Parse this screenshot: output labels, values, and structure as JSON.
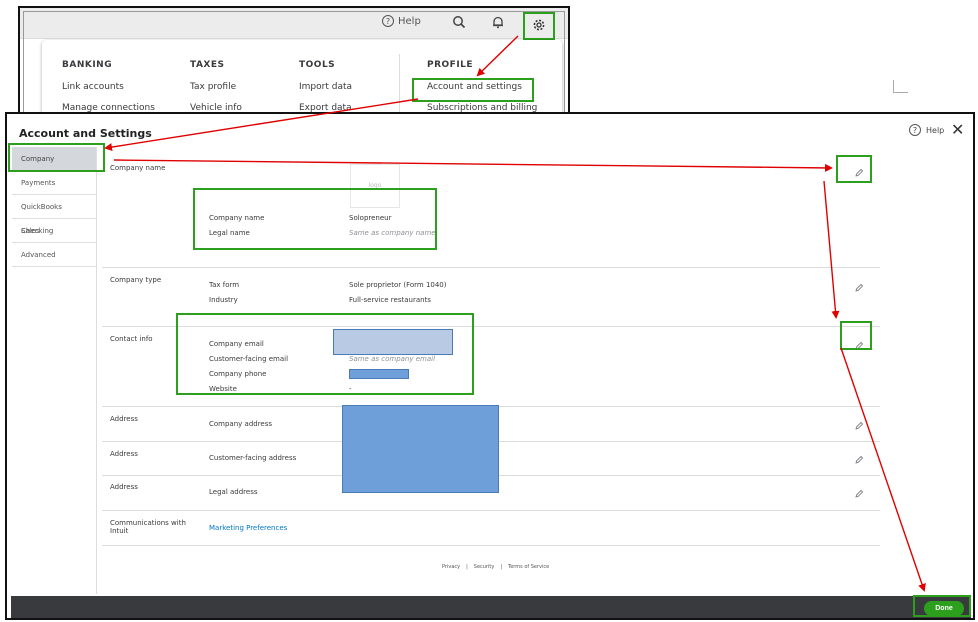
{
  "topbar": {
    "help_label": "Help"
  },
  "gear_menu": {
    "columns": [
      {
        "heading": "BANKING",
        "items": [
          "Link accounts",
          "Manage connections"
        ]
      },
      {
        "heading": "TAXES",
        "items": [
          "Tax profile",
          "Vehicle info"
        ]
      },
      {
        "heading": "TOOLS",
        "items": [
          "Import data",
          "Export data"
        ]
      },
      {
        "heading": "PROFILE",
        "items": [
          "Account and settings",
          "Subscriptions and billing"
        ]
      }
    ]
  },
  "dialog": {
    "title": "Account and Settings",
    "help_label": "Help",
    "close_glyph": "✕",
    "sidebar": [
      "Company",
      "Payments",
      "QuickBooks Checking",
      "Sales",
      "Advanced"
    ],
    "sections": {
      "company_name": {
        "label": "Company name",
        "logo_placeholder": "logo",
        "fields": [
          {
            "label": "Company name",
            "value": "Solopreneur"
          },
          {
            "label": "Legal name",
            "value": "Same as company name"
          }
        ]
      },
      "company_type": {
        "label": "Company type",
        "fields": [
          {
            "label": "Tax form",
            "value": "Sole proprietor (Form 1040)"
          },
          {
            "label": "Industry",
            "value": "Full-service restaurants"
          }
        ]
      },
      "contact_info": {
        "label": "Contact info",
        "fields": [
          {
            "label": "Company email",
            "value": ""
          },
          {
            "label": "Customer-facing email",
            "value": "Same as company email"
          },
          {
            "label": "Company phone",
            "value": ""
          },
          {
            "label": "Website",
            "value": "-"
          }
        ]
      },
      "address_company": {
        "label": "Address",
        "field": "Company address"
      },
      "address_customer": {
        "label": "Address",
        "field": "Customer-facing address"
      },
      "address_legal": {
        "label": "Address",
        "field": "Legal address"
      },
      "communications": {
        "label": "Communications with Intuit",
        "link": "Marketing Preferences"
      }
    },
    "footer_links": [
      "Privacy",
      "|",
      "Security",
      "|",
      "Terms of Service"
    ],
    "done_label": "Done"
  },
  "colors": {
    "accent_green": "#2ca01c",
    "annotation_red": "#e00000",
    "link_blue": "#0077c5",
    "bottom_bar": "#393a3d"
  }
}
